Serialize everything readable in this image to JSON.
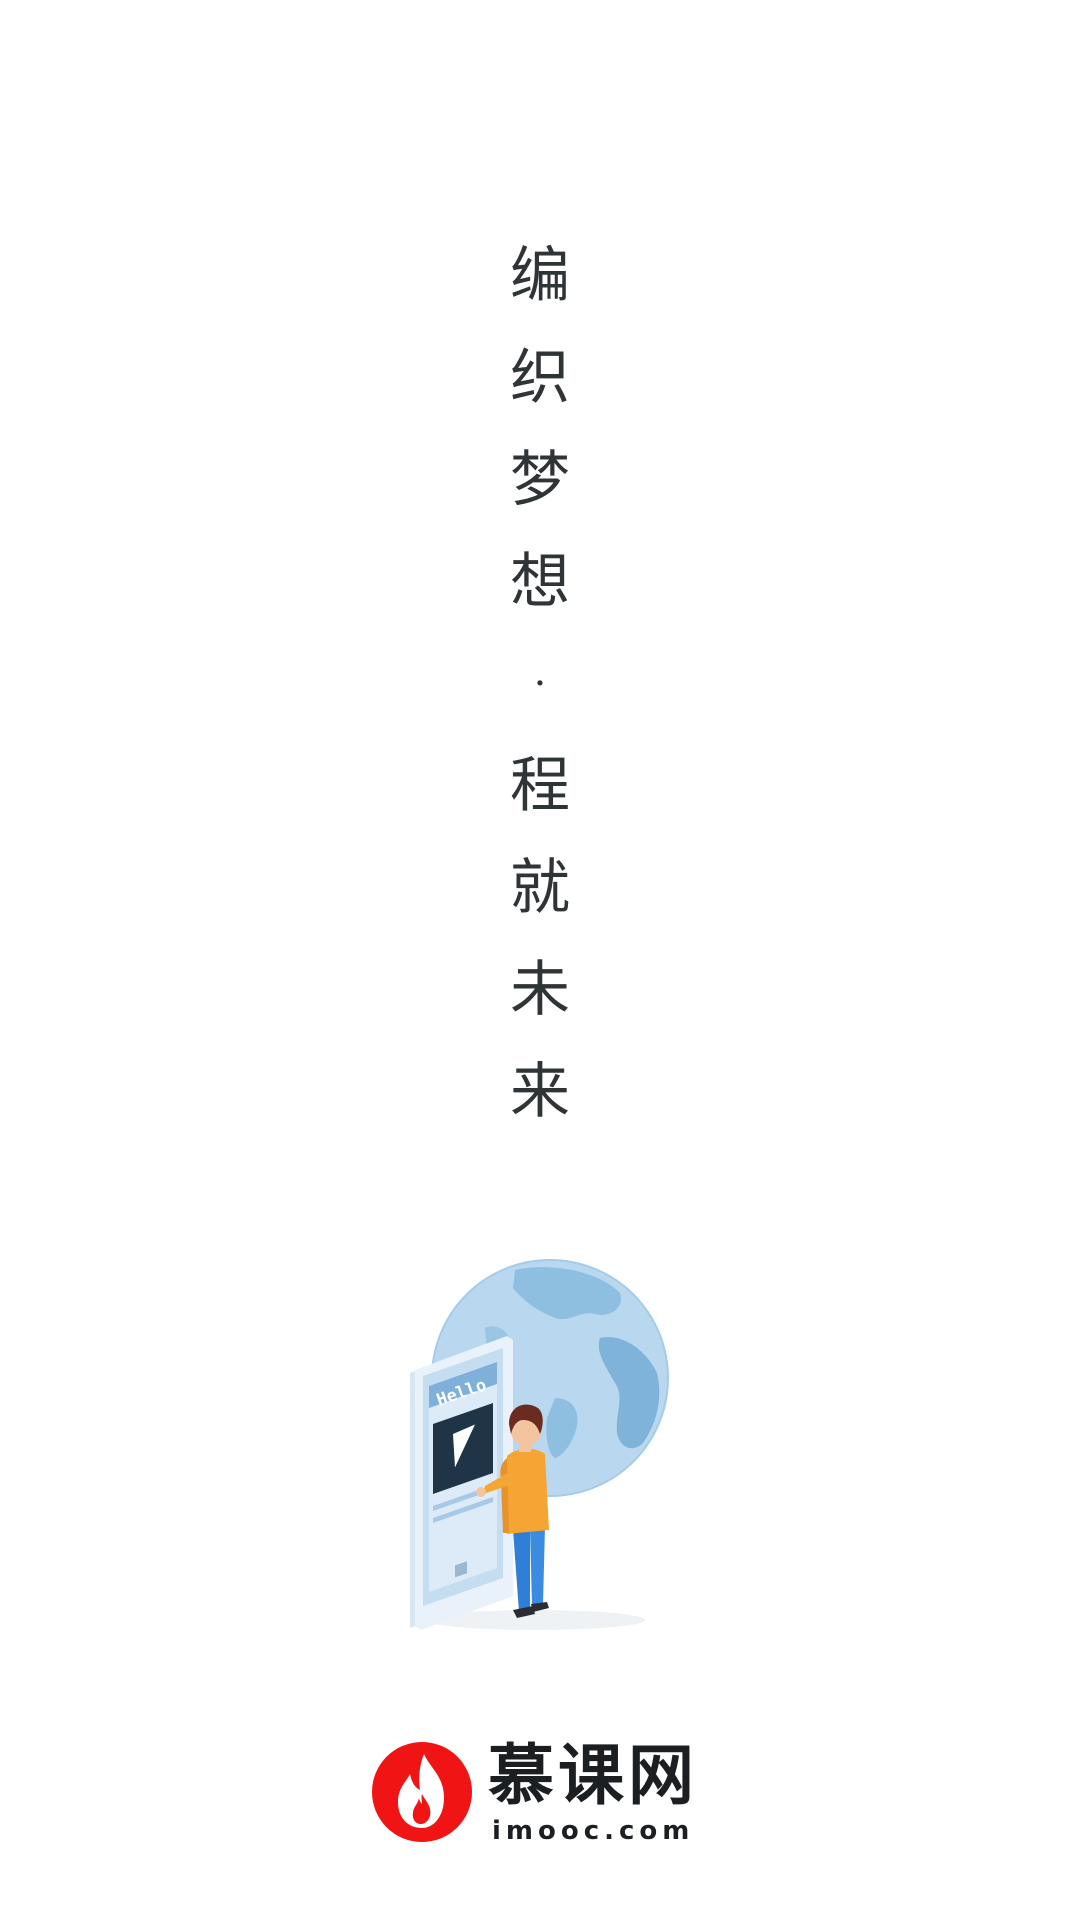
{
  "slogan": {
    "chars": [
      "编",
      "织",
      "梦",
      "想",
      "·",
      "程",
      "就",
      "未",
      "来"
    ]
  },
  "illustration": {
    "screen_text": "Hello",
    "icons": [
      "globe-icon",
      "phone-icon",
      "play-icon",
      "person-icon"
    ]
  },
  "brand": {
    "name": "慕课网",
    "domain": "imooc.com",
    "logo_icon": "flame-icon",
    "logo_color": "#f01414"
  },
  "colors": {
    "background": "#ffffff",
    "text": "#2f3437",
    "globe": "#8fbfe0",
    "phone": "#bcd8ef",
    "shirt": "#f4a534",
    "pants": "#2f7fd6"
  }
}
